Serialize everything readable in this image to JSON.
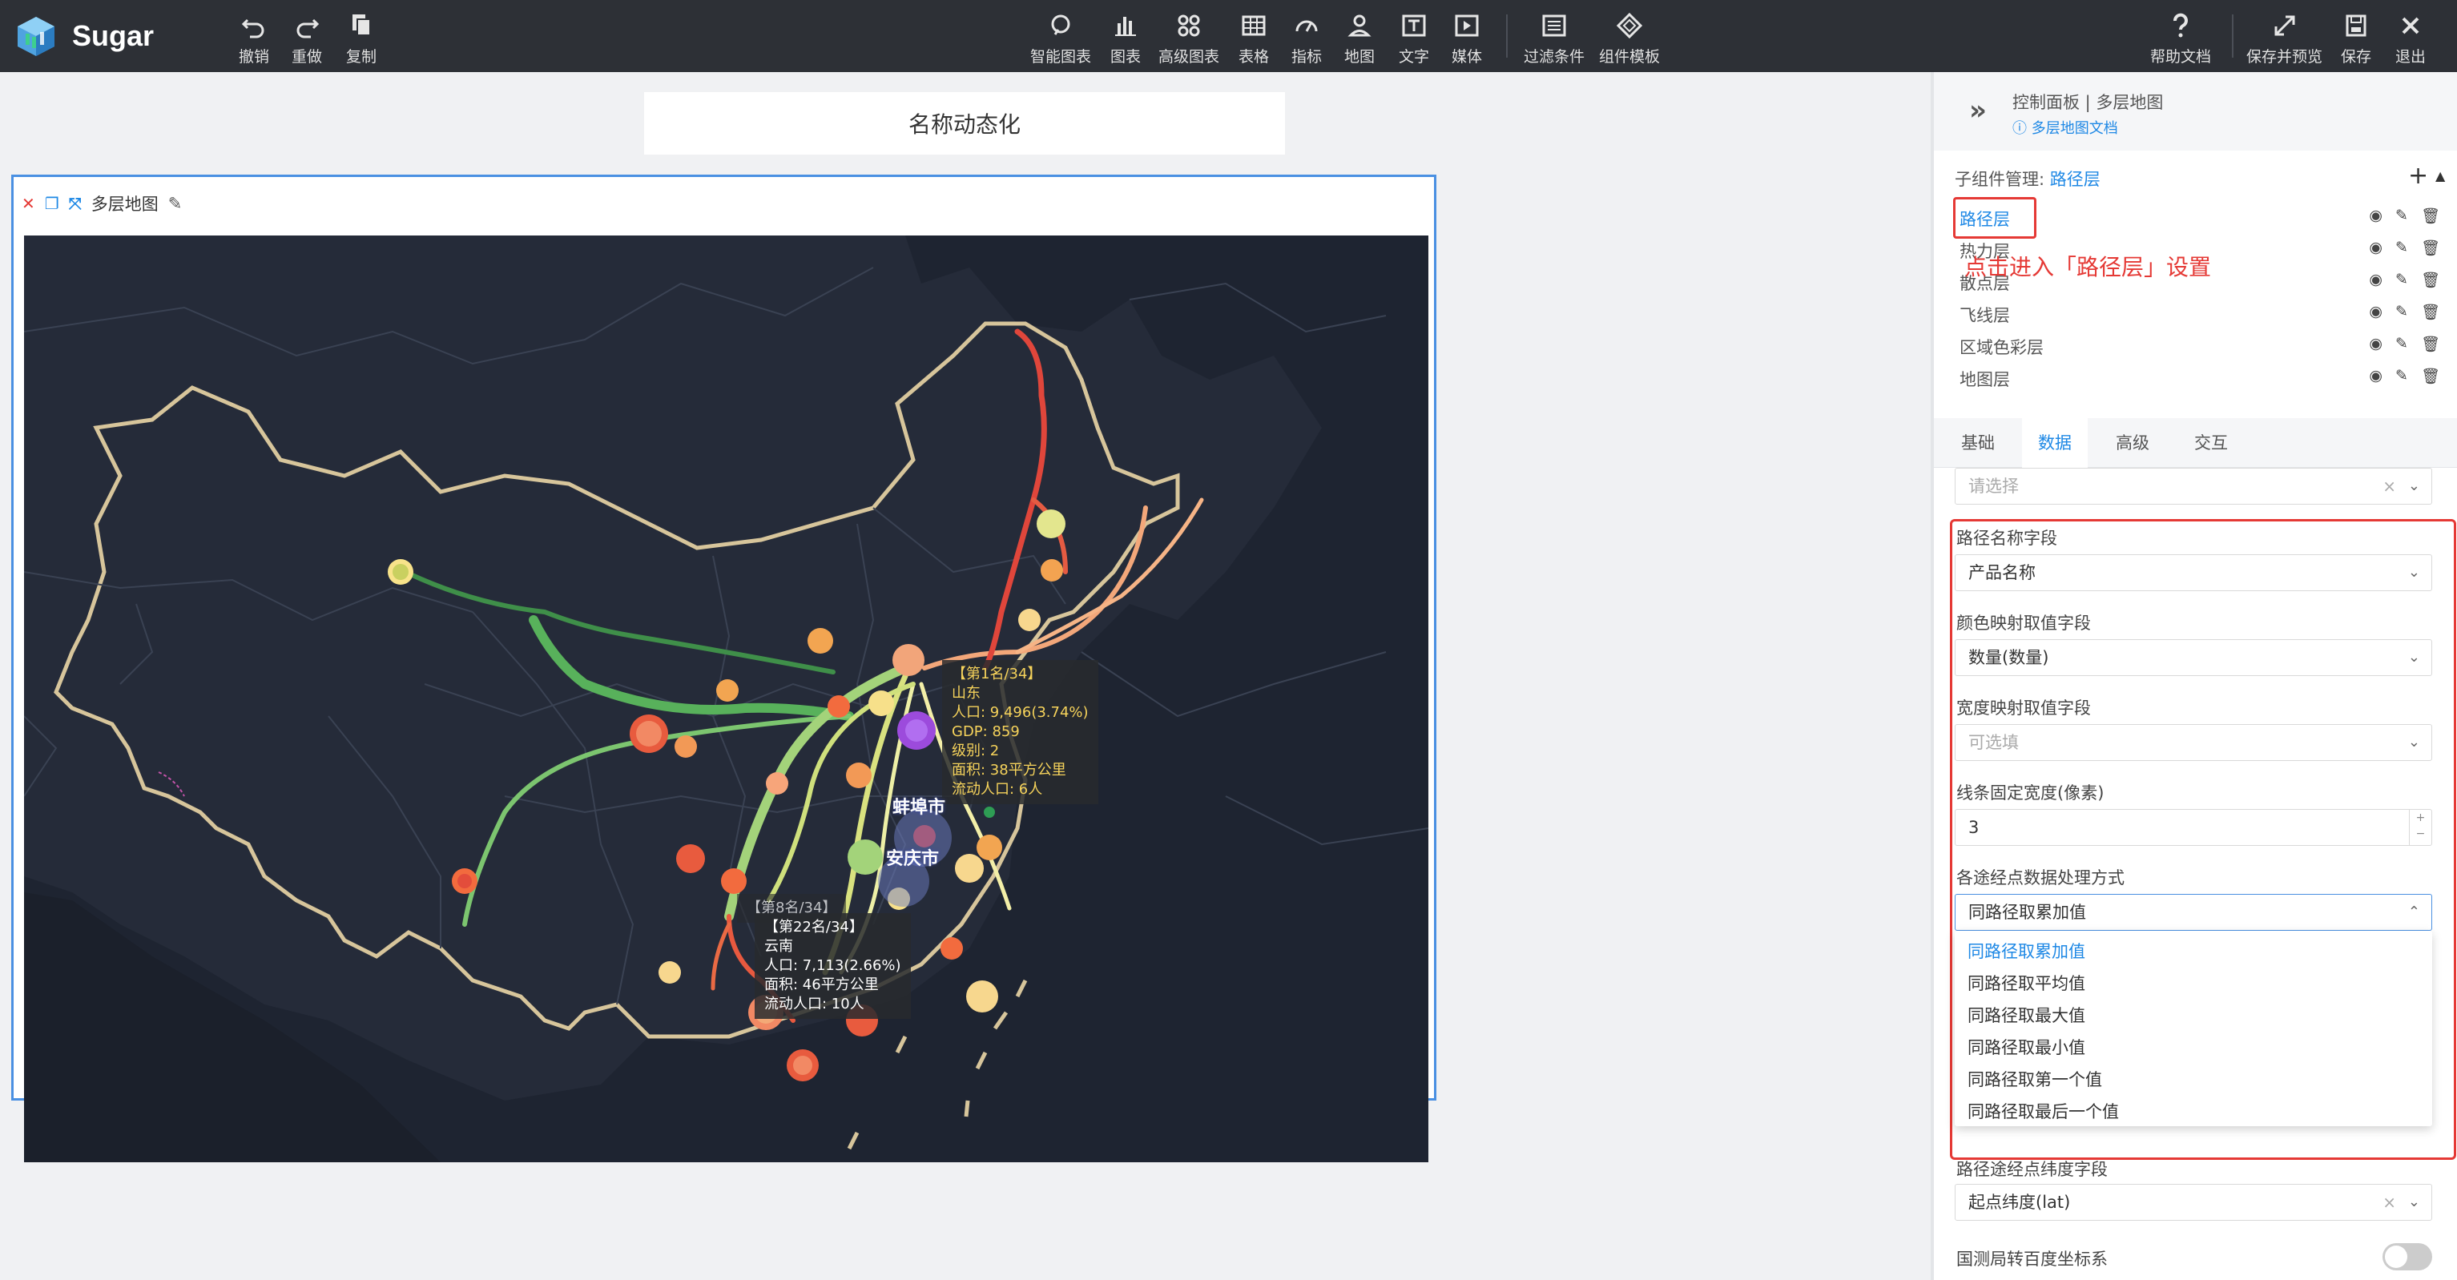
{
  "app": {
    "name": "Sugar"
  },
  "toolbar": {
    "left": [
      {
        "id": "undo",
        "label": "撤销",
        "icon": "undo-icon"
      },
      {
        "id": "redo",
        "label": "重做",
        "icon": "redo-icon"
      },
      {
        "id": "copy",
        "label": "复制",
        "icon": "copy-icon"
      }
    ],
    "center": [
      {
        "id": "smart-chart",
        "label": "智能图表",
        "icon": "smart-chart-icon"
      },
      {
        "id": "chart",
        "label": "图表",
        "icon": "bar-chart-icon"
      },
      {
        "id": "adv-chart",
        "label": "高级图表",
        "icon": "advanced-chart-icon"
      },
      {
        "id": "table",
        "label": "表格",
        "icon": "table-icon"
      },
      {
        "id": "metric",
        "label": "指标",
        "icon": "gauge-icon"
      },
      {
        "id": "map",
        "label": "地图",
        "icon": "map-pin-icon"
      },
      {
        "id": "text",
        "label": "文字",
        "icon": "text-icon"
      },
      {
        "id": "media",
        "label": "媒体",
        "icon": "media-icon"
      },
      {
        "id": "filter",
        "label": "过滤条件",
        "icon": "filter-icon"
      },
      {
        "id": "template",
        "label": "组件模板",
        "icon": "template-icon"
      }
    ],
    "right": [
      {
        "id": "help",
        "label": "帮助文档",
        "icon": "help-icon"
      },
      {
        "id": "save-preview",
        "label": "保存并预览",
        "icon": "expand-icon"
      },
      {
        "id": "save",
        "label": "保存",
        "icon": "save-icon"
      },
      {
        "id": "exit",
        "label": "退出",
        "icon": "close-icon"
      }
    ]
  },
  "canvas": {
    "title": "名称动态化",
    "widget_name": "多层地图"
  },
  "map": {
    "tooltip1": [
      "【第1名/34】",
      "山东",
      "人口: 9,496(3.74%)",
      "GDP: 859",
      "级别: 2",
      "面积: 38平方公里",
      "流动人口: 6人"
    ],
    "tooltip2": [
      "【第22名/34】",
      "云南",
      "人口: 7,113(2.66%)",
      "面积: 46平方公里",
      "流动人口: 10人"
    ],
    "tooltip2_behind": "【第8名/34】",
    "city1": "蚌埠市",
    "city2": "安庆市"
  },
  "panel": {
    "breadcrumb": "控制面板 | 多层地图",
    "doc_link": "多层地图文档",
    "sub_label": "子组件管理:",
    "sub_current": "路径层",
    "layers": [
      "路径层",
      "热力层",
      "散点层",
      "飞线层",
      "区域色彩层",
      "地图层"
    ],
    "annotation": "点击进入「路径层」设置",
    "tabs": [
      "基础",
      "数据",
      "高级",
      "交互"
    ],
    "active_tab": "数据",
    "top_select_placeholder": "请选择",
    "fields": {
      "path_name_label": "路径名称字段",
      "path_name_value": "产品名称",
      "color_label": "颜色映射取值字段",
      "color_value": "数量(数量)",
      "width_label": "宽度映射取值字段",
      "width_placeholder": "可选填",
      "fixed_width_label": "线条固定宽度(像素)",
      "fixed_width_value": "3",
      "process_label": "各途经点数据处理方式",
      "process_value": "同路径取累加值",
      "lat_label": "路径途经点纬度字段",
      "lat_value": "起点纬度(lat)",
      "baidu_label": "国测局转百度坐标系"
    },
    "dropdown_options": [
      "同路径取累加值",
      "同路径取平均值",
      "同路径取最大值",
      "同路径取最小值",
      "同路径取第一个值",
      "同路径取最后一个值"
    ]
  }
}
